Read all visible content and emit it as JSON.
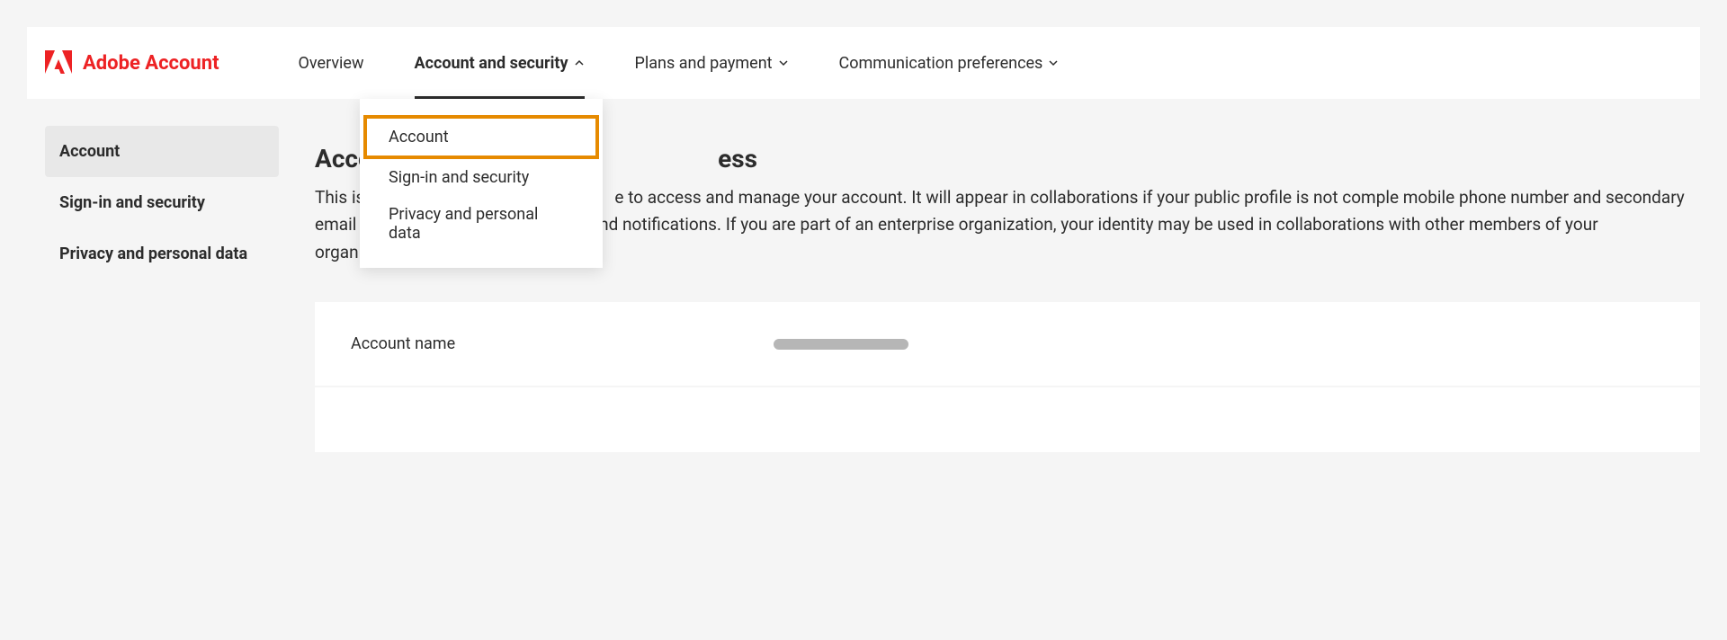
{
  "header": {
    "brand": "Adobe Account",
    "nav": {
      "overview": "Overview",
      "account_security": "Account and security",
      "plans_payment": "Plans and payment",
      "communication": "Communication preferences"
    }
  },
  "sidebar": {
    "items": [
      {
        "label": "Account"
      },
      {
        "label": "Sign-in and security"
      },
      {
        "label": "Privacy and personal data"
      }
    ]
  },
  "dropdown": {
    "items": [
      {
        "label": "Account"
      },
      {
        "label": "Sign-in and security"
      },
      {
        "label": "Privacy and personal data"
      }
    ]
  },
  "main": {
    "title_partial_left": "Acco",
    "title_partial_right": "ess",
    "description": "This is                                                           e to access and manage your account. It will appear in collaborations if your public profile is not comple mobile phone number and secondary email for account security, recovery, and notifications. If you are part of an enterprise organization, your identity may be used in collaborations with other members of your organization.",
    "card": {
      "label": "Account name"
    }
  }
}
